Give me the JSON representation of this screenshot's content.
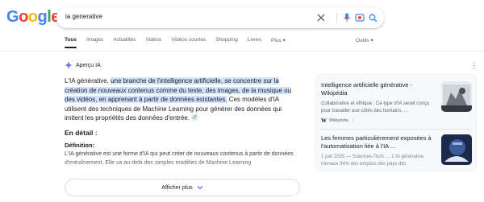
{
  "logo": {
    "text": "Google",
    "colors": [
      "#4285F4",
      "#EA4335",
      "#FBBC05",
      "#4285F4",
      "#34A853",
      "#EA4335"
    ]
  },
  "search": {
    "query": "ia generative"
  },
  "tabs": [
    "Tous",
    "Images",
    "Actualités",
    "Vidéos",
    "Vidéos courtes",
    "Shopping",
    "Livres",
    "Plus"
  ],
  "tools_label": "Outils",
  "ai_overview": {
    "label": "Aperçu IA",
    "intro_plain": "L'IA générative, ",
    "intro_highlight": "une branche de l'intelligence artificielle, se concentre sur la création de nouveaux contenus comme du texte, des images, de la musique ou des vidéos, en apprenant à partir de données existantes.",
    "intro_rest": " Ces modèles d'IA utilisent des techniques de Machine Learning pour générer des données qui imitent les propriétés des données d'entrée.",
    "detail_heading": "En détail :",
    "definition_heading": "Définition:",
    "definition_text": "L'IA générative est une forme d'IA qui peut créer de nouveaux contenus à partir de données d'entraînement. Elle va au-delà des simples modèles de Machine Learning",
    "show_more": "Afficher plus"
  },
  "sources": [
    {
      "title": "Intelligence artificielle générative - Wikipédia",
      "snippet": "Collaborative et éthique : Ce type d'IA serait conçu pour travailler aux côtés des humains, ...",
      "source": "Wikipédia"
    },
    {
      "title": "Les femmes particulièrement exposées à l'automatisation liée à l'IA ...",
      "snippet": "1 juin 2025 — Sciences-Tech. ... L'IA générative menace 34% des emplois des pays dits"
    }
  ],
  "colors": {
    "highlight": "#d3e3fd",
    "accent": "#4285F4"
  }
}
